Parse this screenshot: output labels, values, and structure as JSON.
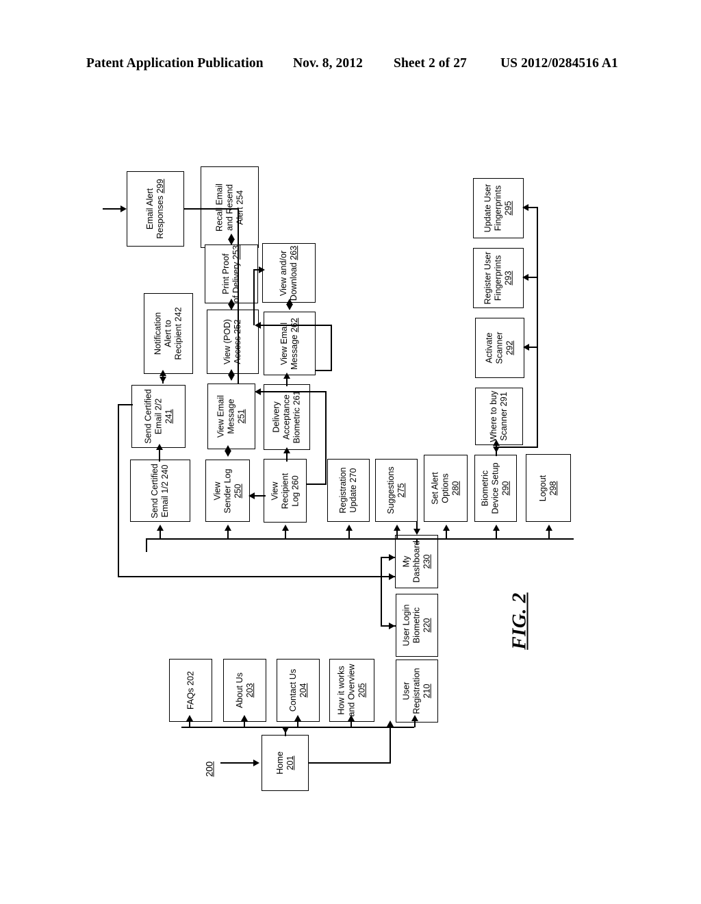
{
  "header": {
    "publication": "Patent Application Publication",
    "date": "Nov. 8, 2012",
    "sheet": "Sheet 2 of 27",
    "number": "US 2012/0284516 A1"
  },
  "figure": {
    "caption": "FIG. 2",
    "system_reference": "200"
  },
  "nodes": [
    {
      "id": "n299",
      "ref": "299",
      "lines": [
        "Email Alert",
        "Responses"
      ],
      "label": "Email Alert Responses 299"
    },
    {
      "id": "n254",
      "ref": "254",
      "lines": [
        "Recall Email",
        "and Resend",
        "Alert"
      ],
      "label": "Recall Email and Resend Alert 254"
    },
    {
      "id": "n253",
      "ref": "253",
      "lines": [
        "Print Proof",
        "of Delivery"
      ],
      "label": "Print Proof of Delivery 253"
    },
    {
      "id": "n263",
      "ref": "263",
      "lines": [
        "View and/or",
        "Download"
      ],
      "label": "View and/or Download 263"
    },
    {
      "id": "n242",
      "ref": "242",
      "lines": [
        "Notification",
        "Alert to",
        "Recipient"
      ],
      "label": "Notification Alert to Recipient 242"
    },
    {
      "id": "n252",
      "ref": "252",
      "lines": [
        "View (POD)",
        "Access"
      ],
      "label": "View (POD) Access 252"
    },
    {
      "id": "n262",
      "ref": "262",
      "lines": [
        "View Email",
        "Message"
      ],
      "label": "View Email Message 262"
    },
    {
      "id": "n241",
      "ref": "241",
      "lines": [
        "Send Certified",
        "Email 2/2"
      ],
      "label": "Send Certified Email 2/2 241"
    },
    {
      "id": "n251",
      "ref": "251",
      "lines": [
        "View Email",
        "Message"
      ],
      "label": "View Email Message 251"
    },
    {
      "id": "n261",
      "ref": "261",
      "lines": [
        "Delivery",
        "Acceptance",
        "Biometric"
      ],
      "label": "Delivery Acceptance Biometric 261"
    },
    {
      "id": "n240",
      "ref": "240",
      "lines": [
        "Send Certified",
        "Email 1/2"
      ],
      "label": "Send Certified Email 1/2 240"
    },
    {
      "id": "n250",
      "ref": "250",
      "lines": [
        "View",
        "Sender Log"
      ],
      "label": "View Sender Log 250"
    },
    {
      "id": "n260",
      "ref": "260",
      "lines": [
        "View",
        "Recipient",
        "Log"
      ],
      "label": "View Recipient Log 260"
    },
    {
      "id": "n270",
      "ref": "270",
      "lines": [
        "Registration",
        "Update"
      ],
      "label": "Registration Update 270"
    },
    {
      "id": "n275",
      "ref": "275",
      "lines": [
        "Suggestions"
      ],
      "label": "Suggestions 275"
    },
    {
      "id": "n280",
      "ref": "280",
      "lines": [
        "Set Alert",
        "Options"
      ],
      "label": "Set Alert Options 280"
    },
    {
      "id": "n290",
      "ref": "290",
      "lines": [
        "Biometric",
        "Device Setup"
      ],
      "label": "Biometric Device Setup 290"
    },
    {
      "id": "n298",
      "ref": "298",
      "lines": [
        "Logout"
      ],
      "label": "Logout 298"
    },
    {
      "id": "n295",
      "ref": "295",
      "lines": [
        "Update User",
        "Fingerprints"
      ],
      "label": "Update User Fingerprints 295"
    },
    {
      "id": "n293",
      "ref": "293",
      "lines": [
        "Register User",
        "Fingerprints"
      ],
      "label": "Register User Fingerprints 293"
    },
    {
      "id": "n292",
      "ref": "292",
      "lines": [
        "Activate",
        "Scanner"
      ],
      "label": "Activate Scanner 292"
    },
    {
      "id": "n291",
      "ref": "291",
      "lines": [
        "Where to buy",
        "Scanner"
      ],
      "label": "Where to buy Scanner 291"
    },
    {
      "id": "n230",
      "ref": "230",
      "lines": [
        "My",
        "Dashboard"
      ],
      "label": "My Dashboard 230"
    },
    {
      "id": "n220",
      "ref": "220",
      "lines": [
        "User Login",
        "Biometric"
      ],
      "label": "User Login Biometric 220"
    },
    {
      "id": "n210",
      "ref": "210",
      "lines": [
        "User",
        "Registration"
      ],
      "label": "User Registration 210"
    },
    {
      "id": "n202",
      "ref": "202",
      "lines": [
        "FAQs"
      ],
      "label": "FAQs 202"
    },
    {
      "id": "n203",
      "ref": "203",
      "lines": [
        "About Us"
      ],
      "label": "About Us 203"
    },
    {
      "id": "n204",
      "ref": "204",
      "lines": [
        "Contact Us"
      ],
      "label": "Contact Us 204"
    },
    {
      "id": "n205",
      "ref": "205",
      "lines": [
        "How it works",
        "and Overview"
      ],
      "label": "How it works and Overview 205"
    },
    {
      "id": "n201",
      "ref": "201",
      "lines": [
        "Home"
      ],
      "label": "Home 201"
    }
  ],
  "node_text": {
    "n299": {
      "l0": "Email Alert",
      "l1": "Responses",
      "ref": "299"
    },
    "n254": {
      "l0": "Recall Email",
      "l1": "and Resend",
      "l2": "Alert 254"
    },
    "n253": {
      "l0": "Print Proof",
      "l1": "of Delivery",
      "ref": "253"
    },
    "n263": {
      "l0": "View and/or",
      "l1": "Download",
      "ref": "263"
    },
    "n242": {
      "l0": "Notification",
      "l1": "Alert to",
      "l2": "Recipient 242"
    },
    "n252": {
      "l0": "View (POD)",
      "l1": "Access 252"
    },
    "n262": {
      "l0": "View Email",
      "l1": "Message",
      "ref": "262"
    },
    "n241": {
      "l0": "Send Certified",
      "l1": "Email 2/2",
      "ref": "241"
    },
    "n251": {
      "l0": "View Email",
      "l1": "Message",
      "ref": "251"
    },
    "n261": {
      "l0": "Delivery",
      "l1": "Acceptance",
      "l2": "Biometric 261"
    },
    "n240": {
      "l0": "Send Certified",
      "l1": "Email 1/2 240"
    },
    "n250": {
      "l0": "View",
      "l1": "Sender Log",
      "ref": "250"
    },
    "n260": {
      "l0": "View",
      "l1": "Recipient",
      "l2": "Log 260"
    },
    "n270": {
      "l0": "Registration",
      "l1": "Update 270"
    },
    "n275": {
      "l0": "Suggestions",
      "ref": "275"
    },
    "n280": {
      "l0": "Set Alert",
      "l1": "Options",
      "ref": "280"
    },
    "n290": {
      "l0": "Biometric",
      "l1": "Device Setup",
      "ref": "290"
    },
    "n298": {
      "l0": "Logout",
      "ref": "298"
    },
    "n295": {
      "l0": "Update User",
      "l1": "Fingerprints",
      "ref": "295"
    },
    "n293": {
      "l0": "Register User",
      "l1": "Fingerprints",
      "ref": "293"
    },
    "n292": {
      "l0": "Activate",
      "l1": "Scanner",
      "ref": "292"
    },
    "n291": {
      "l0": "Where to buy",
      "l1": "Scanner 291"
    },
    "n230": {
      "l0": "My",
      "l1": "Dashboard",
      "ref": "230"
    },
    "n220": {
      "l0": "User Login",
      "l1": "Biometric",
      "ref": "220"
    },
    "n210": {
      "l0": "User",
      "l1": "Registration",
      "ref": "210"
    },
    "n202": {
      "l0": "FAQs 202"
    },
    "n203": {
      "l0": "About Us",
      "ref": "203"
    },
    "n204": {
      "l0": "Contact Us",
      "ref": "204"
    },
    "n205": {
      "l0": "How it works",
      "l1": "and Overview",
      "ref": "205"
    },
    "n201": {
      "l0": "Home",
      "ref": "201"
    }
  }
}
